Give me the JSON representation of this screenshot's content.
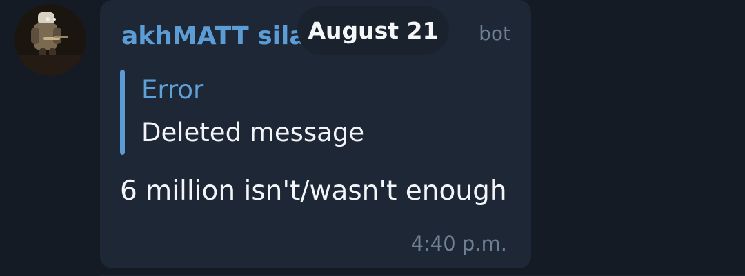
{
  "message": {
    "sender_name": "akhMATT sila",
    "bot_label": "bot",
    "reply": {
      "title": "Error",
      "text": "Deleted message"
    },
    "text": "6 million isn't/wasn't enough",
    "timestamp": "4:40 p.m."
  },
  "date_pill": {
    "label": "August 21"
  },
  "avatar": {
    "icon": "user-avatar"
  },
  "colors": {
    "background": "#141b24",
    "bubble": "#1e2735",
    "accent": "#5d9dd6",
    "muted": "#6f7f92",
    "text": "#f3f5f8"
  }
}
